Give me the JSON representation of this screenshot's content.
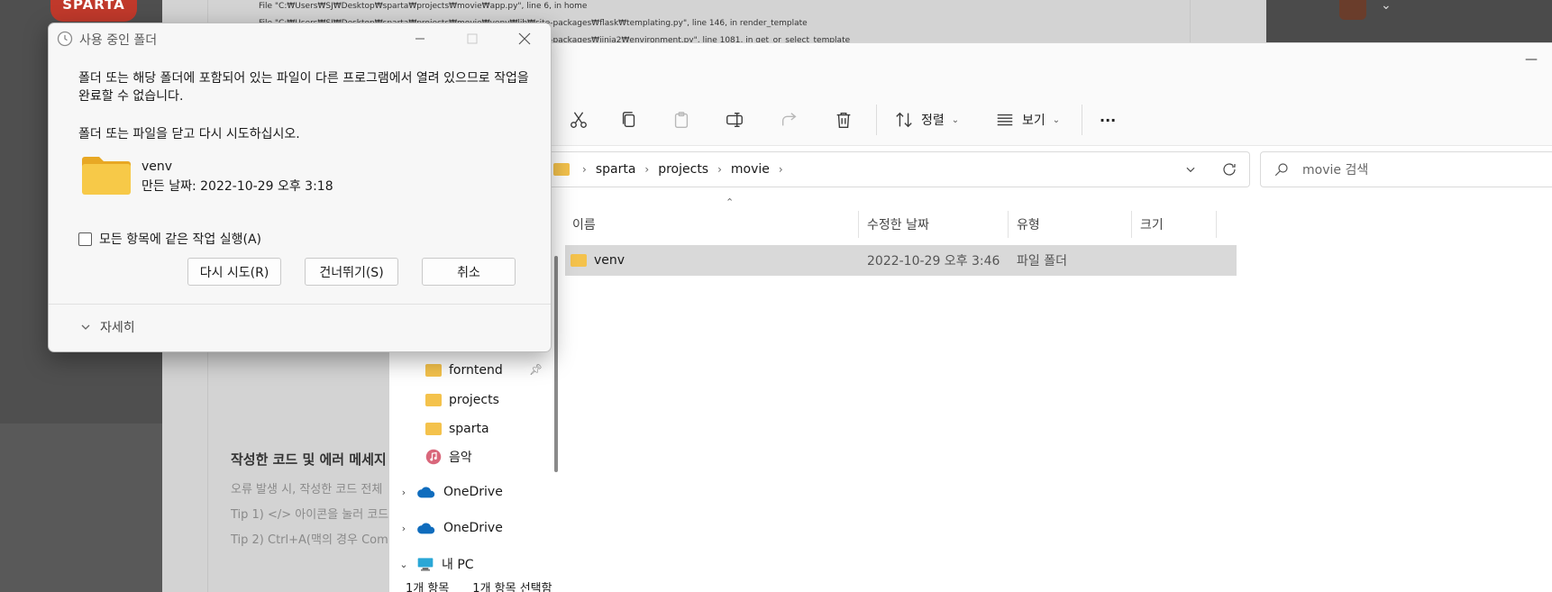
{
  "background": {
    "logo_text": "SPARTA",
    "trace_lines": [
      "File \"C:₩Users₩SJ₩Desktop₩sparta₩projects₩movie₩app.py\", line 6, in home",
      "File \"C:₩Users₩SJ₩Desktop₩sparta₩projects₩movie₩venv₩lib₩site-packages₩flask₩templating.py\", line 146, in render_template",
      "File \"C:₩Users₩SJ₩Desktop₩sparta₩projects₩movie₩venv₩lib₩site-packages₩jinja2₩environment.py\", line 1081, in get_or_select_template"
    ],
    "heading": "작성한 코드 및 에러 메세지",
    "lines": [
      "오류 발생 시, 작성한 코드 전체",
      "Tip 1) </> 아이콘을 눌러 코드",
      "Tip 2) Ctrl+A(맥의 경우 Com"
    ]
  },
  "dialog": {
    "title": "사용 중인 폴더",
    "message": "폴더 또는 해당 폴더에 포함되어 있는 파일이 다른 프로그램에서 열려 있으므로 작업을 완료할 수 없습니다.",
    "instruction": "폴더 또는 파일을 닫고 다시 시도하십시오.",
    "item_name": "venv",
    "item_date": "만든 날짜: 2022-10-29 오후 3:18",
    "checkbox_label": "모든 항목에 같은 작업 실행(A)",
    "checkbox_checked": false,
    "buttons": {
      "retry": "다시 시도(R)",
      "skip": "건너뛰기(S)",
      "cancel": "취소"
    },
    "details_label": "자세히"
  },
  "explorer": {
    "toolbar": {
      "sort_label": "정렬",
      "view_label": "보기",
      "more_label": "···"
    },
    "breadcrumb": [
      "sparta",
      "projects",
      "movie"
    ],
    "search_placeholder": "movie 검색",
    "nav_items": [
      {
        "label": "forntend",
        "type": "folder",
        "pinned": true
      },
      {
        "label": "projects",
        "type": "folder"
      },
      {
        "label": "sparta",
        "type": "folder"
      },
      {
        "label": "음악",
        "type": "music"
      },
      {
        "label": "OneDrive",
        "type": "cloud"
      },
      {
        "label": "OneDrive",
        "type": "cloud"
      },
      {
        "label": "내 PC",
        "type": "pc"
      }
    ],
    "columns": [
      "이름",
      "수정한 날짜",
      "유형",
      "크기"
    ],
    "rows": [
      {
        "name": "venv",
        "modified": "2022-10-29 오후 3:46",
        "type": "파일 폴더",
        "size": ""
      }
    ],
    "status": {
      "item_count": "1개 항목",
      "selected": "1개 항목 선택함"
    }
  },
  "colors": {
    "folder": "#f4c24c",
    "selection": "#d9d9d9",
    "onedrive": "#0f6cbd"
  }
}
